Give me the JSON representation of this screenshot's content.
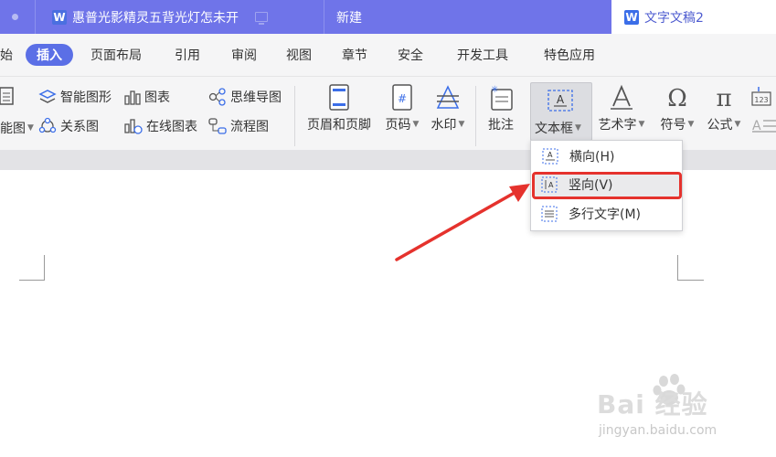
{
  "titlebar": {
    "tabs": [
      {
        "label": "惠普光影精灵五背光灯怎未开",
        "icon": "wps-writer-icon"
      },
      {
        "label": "新建"
      },
      {
        "label": "文字文稿2",
        "icon": "wps-writer-icon"
      }
    ]
  },
  "menubar": {
    "items": [
      "始",
      "插入",
      "页面布局",
      "引用",
      "审阅",
      "视图",
      "章节",
      "安全",
      "开发工具",
      "特色应用"
    ],
    "active": "插入"
  },
  "ribbon": {
    "small_buttons": {
      "smart_art": "智能图形",
      "relation": "关系图",
      "chart": "图表",
      "online_chart": "在线图表",
      "mind_map": "思维导图",
      "flowchart": "流程图",
      "left_partial": "能图"
    },
    "big_buttons": {
      "header_footer": "页眉和页脚",
      "page_number": "页码",
      "watermark": "水印",
      "comment": "批注",
      "textbox": "文本框",
      "wordart": "艺术字",
      "symbol": "符号",
      "formula": "公式"
    }
  },
  "dropdown": {
    "items": [
      {
        "label": "横向(H)",
        "icon": "horizontal-textbox-icon"
      },
      {
        "label": "竖向(V)",
        "icon": "vertical-textbox-icon"
      },
      {
        "label": "多行文字(M)",
        "icon": "multiline-text-icon"
      }
    ],
    "highlighted": "竖向(V)"
  },
  "watermark": {
    "brand": "Bai 经验",
    "url": "jingyan.baidu.com"
  },
  "colors": {
    "titlebar": "#6f74e9",
    "active_menu": "#5b6fe6",
    "annotation_red": "#e5322d"
  }
}
